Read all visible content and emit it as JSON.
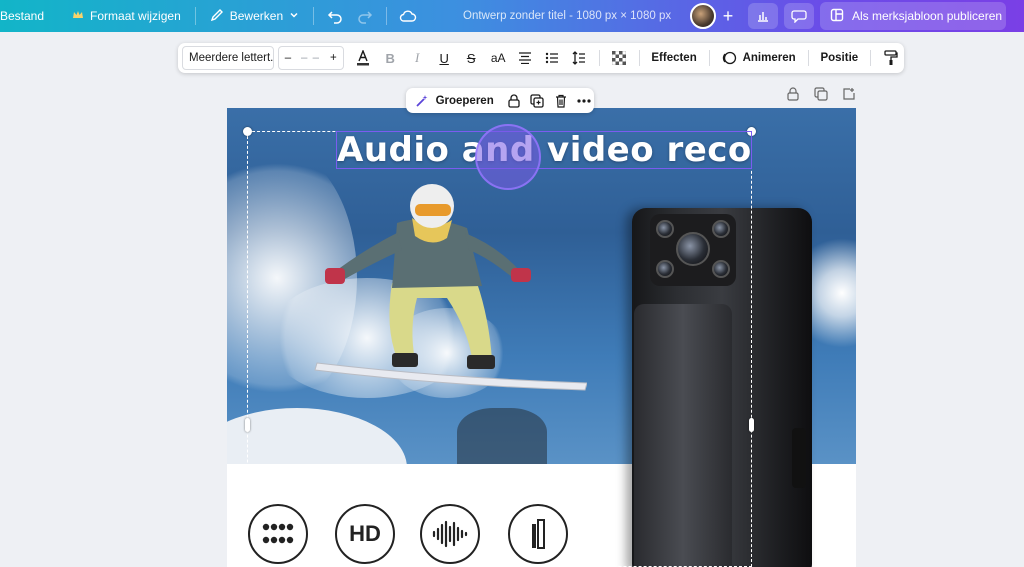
{
  "topbar": {
    "file_label": "Bestand",
    "resize_label": "Formaat wijzigen",
    "edit_label": "Bewerken",
    "doc_title": "Ontwerp zonder titel - 1080 px × 1080 px",
    "publish_label": "Als merksjabloon publiceren"
  },
  "text_toolbar": {
    "font": "Meerdere lettert...",
    "font_size": "– –",
    "effects_label": "Effecten",
    "animate_label": "Animeren",
    "position_label": "Positie",
    "case_label": "aA"
  },
  "group_toolbar": {
    "group_label": "Groeperen"
  },
  "canvas": {
    "headline": "Audio and video recorder",
    "feature_icons": [
      "grid-dots-icon",
      "HD",
      "waveform-icon",
      "bar-icon"
    ],
    "hd_label": "HD"
  },
  "colors": {
    "topbar_gradient_start": "#12b5c8",
    "topbar_gradient_end": "#7a3fe6",
    "selection": "#7b5cf0"
  }
}
